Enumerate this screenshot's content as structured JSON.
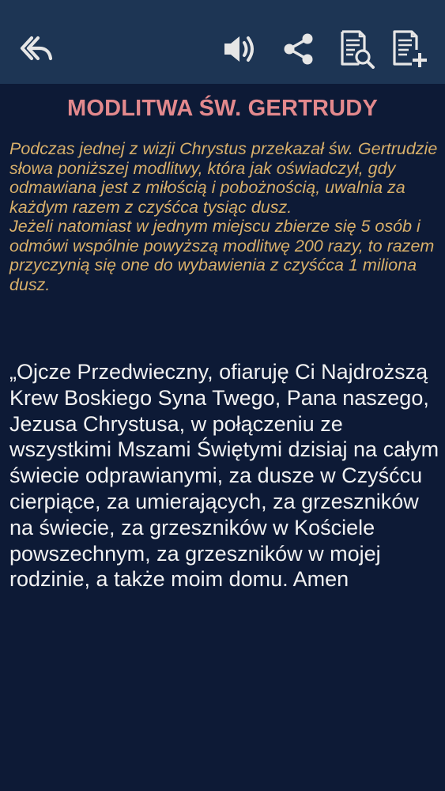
{
  "toolbar": {
    "back_icon": "reply-arrow-icon",
    "sound_icon": "speaker-icon",
    "share_icon": "share-icon",
    "search_icon": "document-search-icon",
    "add_icon": "document-add-icon",
    "icon_color": "#e6e6e6",
    "background": "#1d3554"
  },
  "content": {
    "title": "MODLITWA ŚW. GERTRUDY",
    "intro_p1": "Podczas jednej z wizji Chrystus przekazał św. Gertrudzie słowa poniższej modlitwy, która jak oświadczył, gdy odmawiana jest z miłością i pobożnością, uwalnia za każdym razem z czyśćca tysiąc dusz.",
    "intro_p2": "Jeżeli natomiast w jednym miejscu zbierze się 5 osób i odmówi wspólnie powyższą modlitwę 200 razy, to razem przyczynią się one do wybawienia z czyśćca 1 miliona dusz.",
    "prayer": "„Ojcze Przedwieczny, ofiaruję Ci Najdroższą Krew Boskiego Syna Twego, Pana naszego, Jezusa Chrystusa, w połączeniu ze wszystkimi Mszami Świętymi dzisiaj na całym świecie odprawianymi, za dusze w Czyśćcu cierpiące, za umierających, za grzeszników na świecie, za grzeszników w Kościele powszechnym, za grzeszników w mojej rodzinie, a także moim domu. Amen",
    "title_color": "#e3898d",
    "intro_color": "#d9b06a",
    "prayer_color": "#f2f2f2",
    "background": "#0d1a36"
  }
}
